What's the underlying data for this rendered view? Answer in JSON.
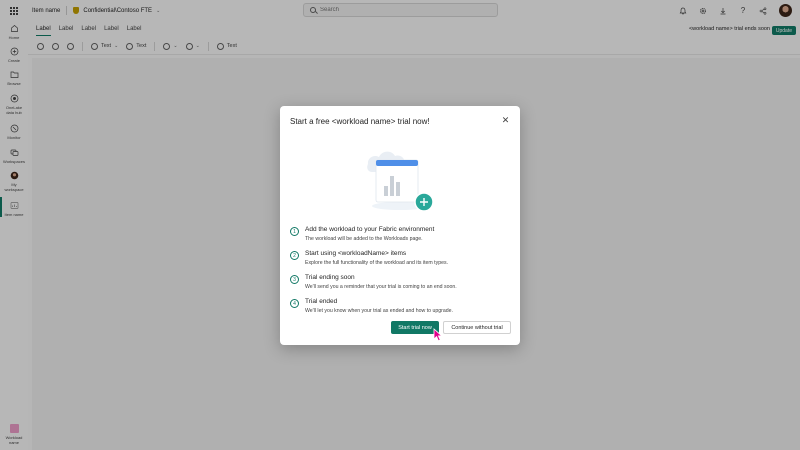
{
  "header": {
    "item_name": "Item name",
    "sensitivity_label": "Confidential\\Contoso FTE",
    "search_placeholder": "Search",
    "icons": [
      "waffle-icon",
      "shield-icon",
      "bell-icon",
      "gear-icon",
      "download-icon",
      "help-icon",
      "share-icon",
      "avatar"
    ]
  },
  "rail": {
    "items": [
      {
        "label": "Home",
        "icon": "home-icon"
      },
      {
        "label": "Create",
        "icon": "plus-circle-icon"
      },
      {
        "label": "Browse",
        "icon": "folder-icon"
      },
      {
        "label": "OneLake data hub",
        "icon": "onelake-icon"
      },
      {
        "label": "Monitor",
        "icon": "monitor-icon"
      },
      {
        "label": "Workspaces",
        "icon": "workspaces-icon"
      },
      {
        "label": "My workspace",
        "icon": "my-workspace-icon"
      },
      {
        "label": "Item name",
        "icon": "item-icon"
      }
    ],
    "bottom_label": "Workload name"
  },
  "ribbon": {
    "tabs": [
      "Label",
      "Label",
      "Label",
      "Label",
      "Label"
    ],
    "trial_note": "<workload name> trial ends soon",
    "update_label": "Update"
  },
  "toolbar": {
    "text_label_1": "Text",
    "text_label_2": "Text",
    "text_label_3": "Text"
  },
  "dialog": {
    "title": "Start a free <workload name> trial now!",
    "close_icon": "close-icon",
    "steps": [
      {
        "num": "1",
        "title": "Add the workload to your Fabric environment",
        "desc": "The workload will be added to the Workloads page."
      },
      {
        "num": "2",
        "title": "Start using <workloadName> items",
        "desc": "Explore the full functionality of the workload and its item types."
      },
      {
        "num": "3",
        "title": "Trial ending soon",
        "desc": "We'll send you a reminder that your trial is coming to an end soon."
      },
      {
        "num": "4",
        "title": "Trial ended",
        "desc": "We'll let you know when your trial as ended and how to upgrade."
      }
    ],
    "primary_label": "Start trial now",
    "secondary_label": "Continue without trial"
  },
  "colors": {
    "accent": "#117865",
    "illustration_blue": "#4f8fe8",
    "plus_teal": "#2aa89a"
  }
}
